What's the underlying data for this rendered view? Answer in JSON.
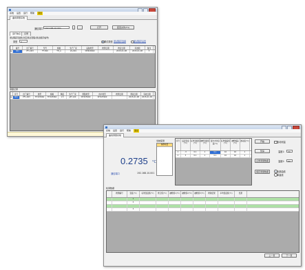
{
  "menu": [
    "系统",
    "设置",
    "运行",
    "帮助",
    "退出"
  ],
  "back_window": {
    "tab": "曲线测量系统",
    "serial_label": "通信端口",
    "serial_value": "192.168.10.001",
    "open_button": "打开",
    "settings_button": "配置文件(F4)",
    "sub_tabs": [
      "运行信息",
      "记录"
    ],
    "group1_label": "测试程序选择(对应测试流程/测试顺序编号)",
    "type_label": "类型",
    "type_value": "A",
    "radio1_label": "调试类型",
    "link1": "测试程序选择",
    "link2": "测试程序设置",
    "grid1_headers": [
      "",
      "编号",
      "出厂编号",
      "型号",
      "规格",
      "生产厂家",
      "设备类型",
      "检测日期",
      "检定日期",
      "有效期",
      "备注"
    ],
    "grid1_rows": [
      [
        "►",
        "001",
        "PF1-003",
        "FT-300",
        "TH_A",
        "ZL-001",
        "DH820960",
        "",
        "2015-01-08",
        "2015-01-08",
        "3"
      ]
    ],
    "group2_label": "测量记录",
    "grid2_headers": [
      "",
      "序号",
      "出厂编号",
      "类型",
      "规格",
      "精度",
      "生产厂家",
      "测量类型",
      "用户类型",
      "检测日期",
      "测试日期",
      "有效日期"
    ],
    "grid2_rows": [
      [
        "►",
        "001",
        "PF1-003",
        "TH325960",
        "TH325960",
        "1.5",
        "JZT-100",
        "DH325960",
        "DH325960",
        "",
        "2015-01-08",
        "2015-01-09"
      ]
    ]
  },
  "front_window": {
    "tab": "曲线测量系统",
    "menu_extra": "退出",
    "reading": "0.2735",
    "unit": "°C",
    "port_label": "通信端口",
    "port_value": "192.168.10.001",
    "list_title": "当前探测",
    "list_items": [
      "探测项目"
    ],
    "table_headers": [
      "序号",
      "设定温度(℃)",
      "标准温度值(℃)",
      "被检温度值(℃)",
      "最大允许误差(℃)",
      "标准偏差值(℃)",
      "被检偏差(℃)",
      "波动度(℃)"
    ],
    "table_rows": [
      [
        "1",
        "-3",
        "0.1",
        "1",
        "0.1",
        "10",
        "10",
        "1"
      ],
      [
        "2",
        "3",
        "0.1",
        "1",
        "0.1",
        "10",
        "10",
        "1"
      ]
    ],
    "side_controls": [
      {
        "label": "开始",
        "check": "自动测温"
      },
      {
        "label": "暂停",
        "check": "温度1:",
        "value": "30"
      },
      {
        "label": "记录测量数据",
        "check": "温度2:",
        "value": "60"
      },
      {
        "label": "保存测量数据",
        "radio1": "全部曲线",
        "radio2": "单曲线"
      }
    ],
    "lower_group": "检测数据",
    "lower_headers": [
      "",
      "检测编号",
      "温度(℃)",
      "标准温度值(℃)",
      "修正值(℃)",
      "被检值1(℃)",
      "被检值2(℃)",
      "被检值3(℃)",
      "检验结果",
      "平均温度值(℃)",
      "结果"
    ],
    "lower_rows": [
      [
        "",
        "",
        "1",
        "",
        "",
        "",
        "",
        "",
        "",
        "",
        ""
      ],
      [
        "",
        "",
        "2",
        "",
        "",
        "",
        "",
        "",
        "",
        "",
        ""
      ],
      [
        "",
        "",
        "",
        "",
        "",
        "",
        "",
        "",
        "",
        "",
        ""
      ],
      [
        "",
        "",
        "3",
        "",
        "",
        "",
        "",
        "",
        "",
        "",
        ""
      ]
    ],
    "lower_button": "生成",
    "pager_prev": "上一页",
    "pager_next": "下一页"
  },
  "colors": {
    "accent": "#2f6fd6",
    "menu_highlight": "#f2d200",
    "grid_bg": "#ababab",
    "green": "#aee0a6",
    "status": "#fff8d8"
  }
}
